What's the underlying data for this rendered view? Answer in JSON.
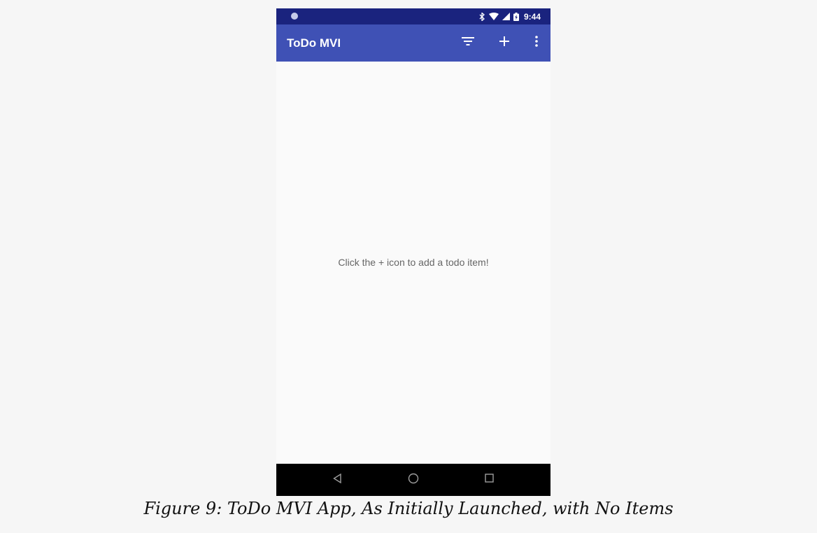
{
  "status_bar": {
    "time": "9:44",
    "icons": [
      "notification-dot-icon",
      "bluetooth-icon",
      "wifi-icon",
      "cell-signal-icon",
      "battery-icon"
    ]
  },
  "app_bar": {
    "title": "ToDo MVI",
    "actions": [
      "filter-icon",
      "add-icon",
      "overflow-menu-icon"
    ]
  },
  "content": {
    "empty_message": "Click the + icon to add a todo item!"
  },
  "nav_bar": {
    "buttons": [
      "back-icon",
      "home-icon",
      "recents-icon"
    ]
  },
  "caption": {
    "text": "Figure 9: ToDo MVI App, As Initially Launched, with No Items"
  },
  "colors": {
    "status_bar": "#1a237e",
    "app_bar": "#3f51b5",
    "content_background": "#fafafa",
    "nav_bar": "#000000",
    "page_background": "#f6f6f6"
  }
}
